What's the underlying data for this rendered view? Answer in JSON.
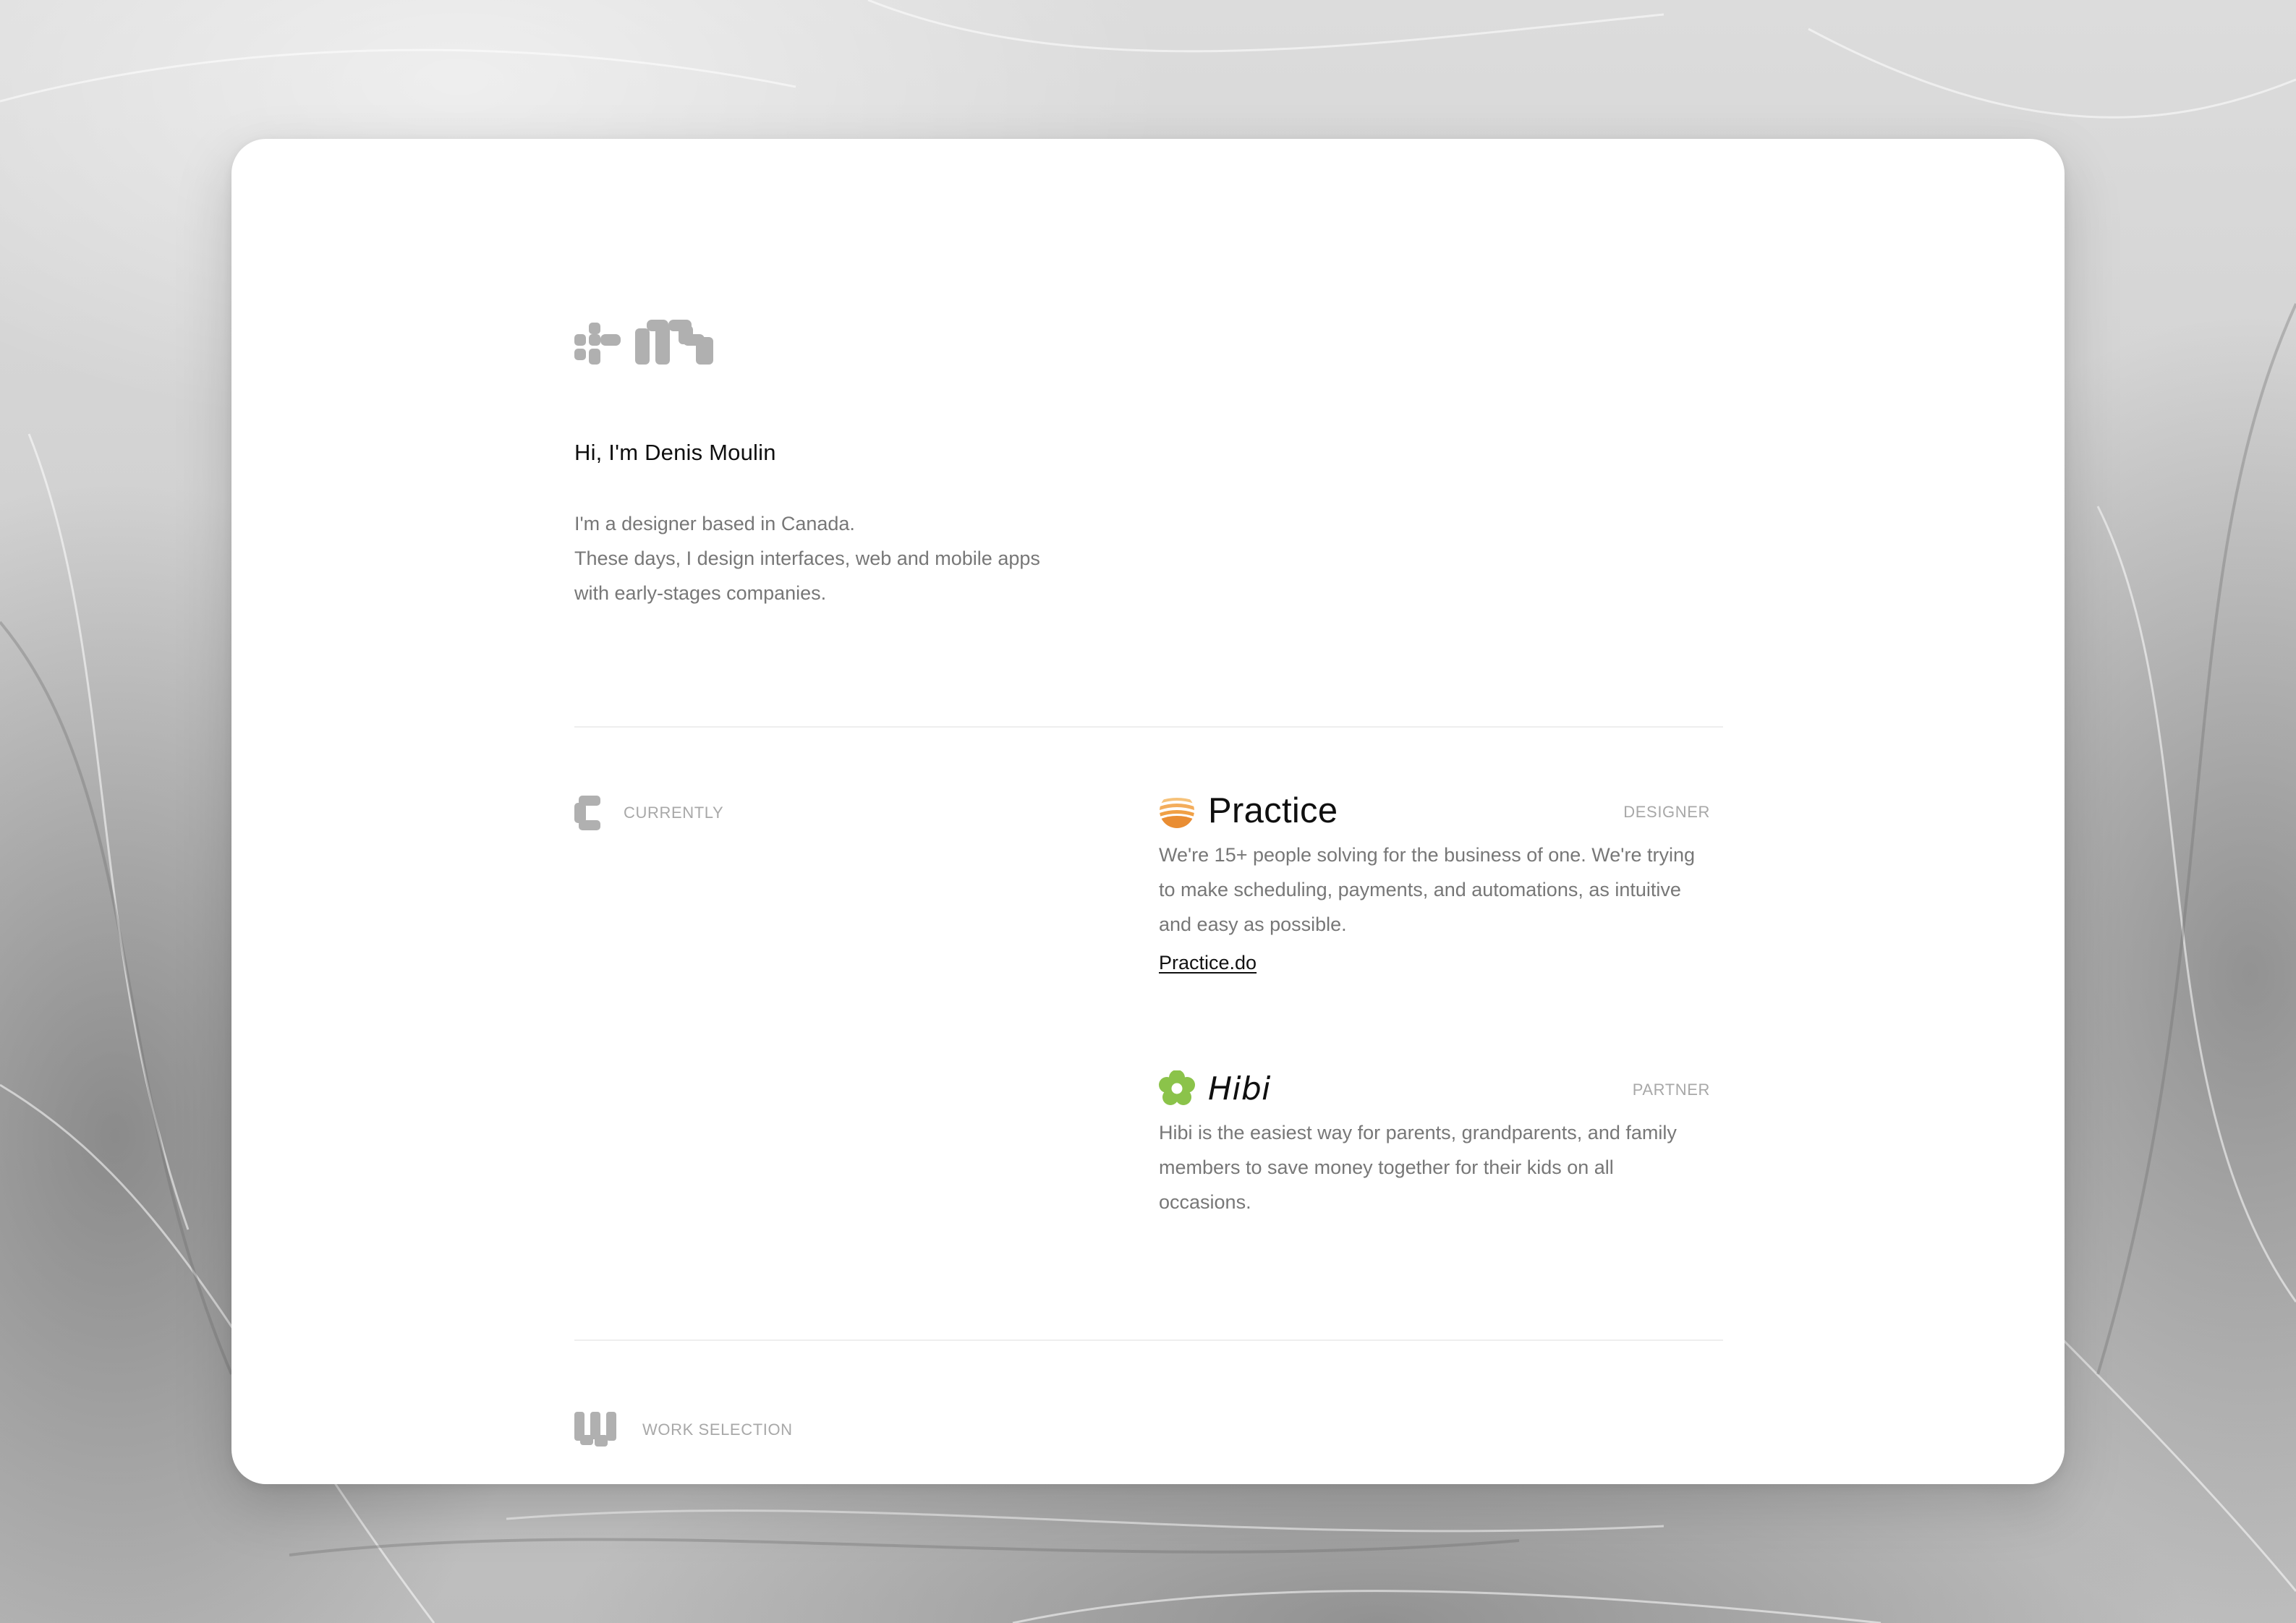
{
  "colors": {
    "card_background": "#ffffff",
    "heading_text": "#0f0f0f",
    "body_text": "#777777",
    "muted_label": "#a8a8a8",
    "practice_accent": "#f0a046",
    "hibi_accent": "#8bc34a",
    "logo_gray": "#b0b0b0"
  },
  "logo": {
    "icon": "dm-monogram-logo"
  },
  "intro": {
    "greeting": "Hi, I'm Denis Moulin",
    "bio_lines": [
      "I'm a designer based in Canada.",
      "These days, I design interfaces, web and mobile apps",
      "with early-stages companies."
    ]
  },
  "currently": {
    "label": "CURRENTLY",
    "icon": "bracket-c-icon",
    "jobs": [
      {
        "name": "Practice",
        "role": "DESIGNER",
        "icon": "practice-logo-icon",
        "description": "We're 15+ people solving for the business of one. We're trying to make scheduling, payments, and automations, as intuitive and easy as possible.",
        "link_text": "Practice.do"
      },
      {
        "name": "Hibi",
        "role": "PARTNER",
        "icon": "hibi-flower-icon",
        "description": "Hibi is the easiest way for parents, grandparents, and family members to save money together for their kids on all occasions."
      }
    ]
  },
  "work_selection": {
    "label": "WORK SELECTION",
    "icon": "w-block-icon"
  }
}
